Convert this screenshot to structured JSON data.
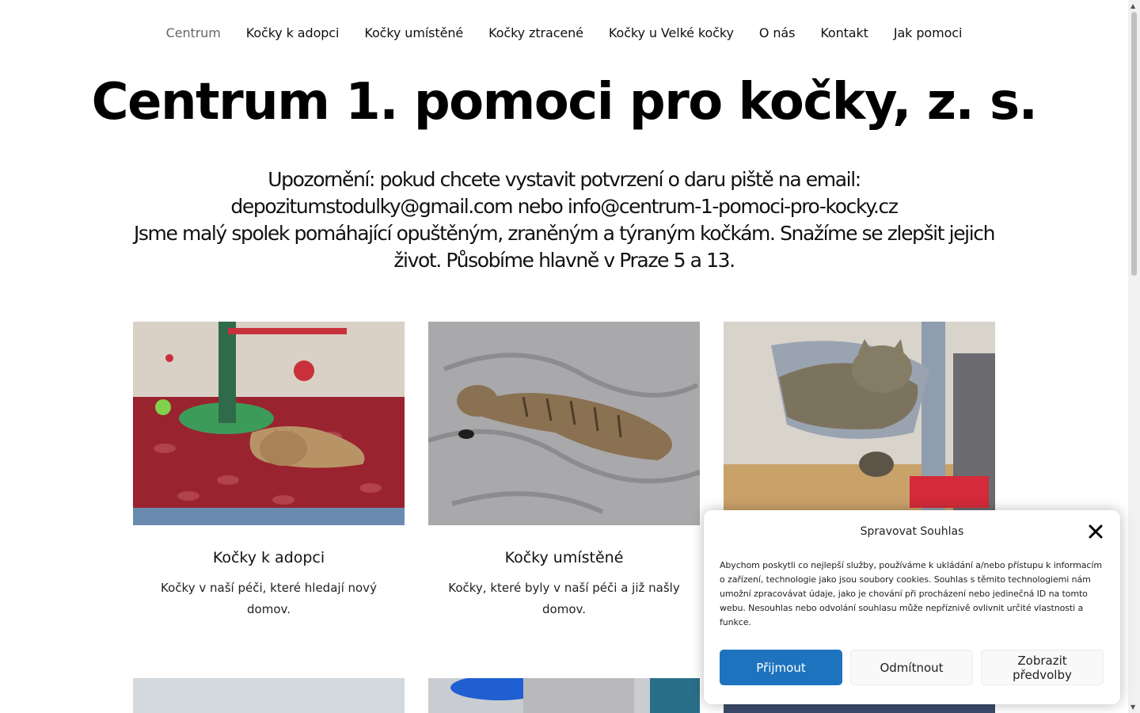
{
  "nav": {
    "items": [
      {
        "label": "Centrum",
        "active": true
      },
      {
        "label": "Kočky k adopci"
      },
      {
        "label": "Kočky umístěné"
      },
      {
        "label": "Kočky ztracené"
      },
      {
        "label": "Kočky u Velké kočky"
      },
      {
        "label": "O nás"
      },
      {
        "label": "Kontakt"
      },
      {
        "label": "Jak pomoci"
      }
    ]
  },
  "page": {
    "title": "Centrum 1. pomoci pro kočky, z. s.",
    "notice": "Upozornění: pokud chcete vystavit potvrzení o daru piště na email: depozitumstodulky@gmail.com nebo info@centrum-1-pomoci-pro-kocky.cz",
    "description": "Jsme malý spolek pomáhající opuštěným, zraněným a týraným kočkám. Snažíme se zlepšit jejich život. Působíme hlavně v Praze 5 a 13."
  },
  "cards": [
    {
      "title": "Kočky k adopci",
      "text": "Kočky v naší péči, které hledají nový domov.",
      "image": "cat-on-red-blanket-photo"
    },
    {
      "title": "Kočky umístěné",
      "text": "Kočky, které byly v naší péči a již našly domov.",
      "image": "cat-sleeping-on-gray-blanket-photo"
    },
    {
      "title": "",
      "text": "",
      "image": "cat-on-scratching-post-photo"
    }
  ],
  "consent": {
    "title": "Spravovat Souhlas",
    "text": "Abychom poskytli co nejlepší služby, používáme k ukládání a/nebo přístupu k informacím o zařízení, technologie jako jsou soubory cookies. Souhlas s těmito technologiemi nám umožní zpracovávat údaje, jako je chování při procházení nebo jedinečná ID na tomto webu. Nesouhlas nebo odvolání souhlasu může nepříznivě ovlivnit určité vlastnosti a funkce.",
    "accept_label": "Přijmout",
    "deny_label": "Odmítnout",
    "preferences_label": "Zobrazit předvolby",
    "accent_color": "#1e73be"
  }
}
